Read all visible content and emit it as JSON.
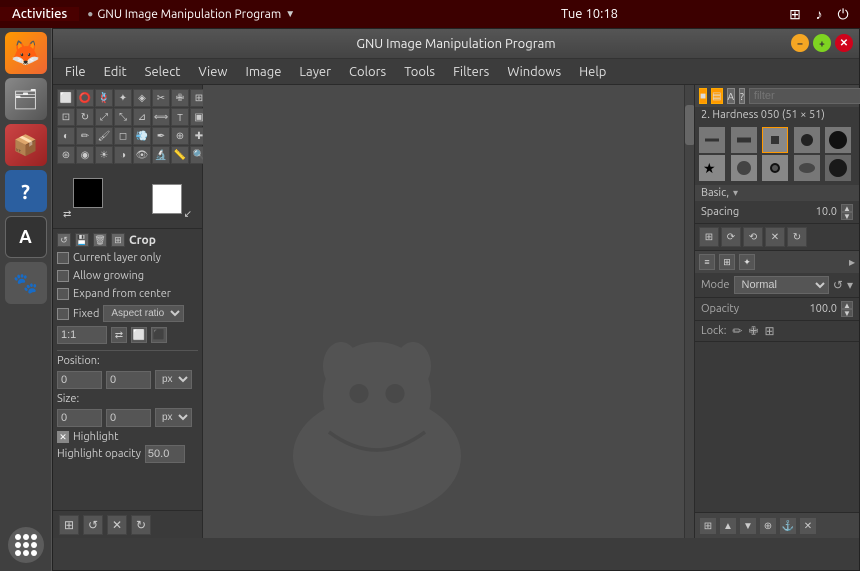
{
  "system_bar": {
    "activities": "Activities",
    "app_name": "GNU Image Manipulation Program",
    "clock": "Tue 10:18"
  },
  "gimp": {
    "title": "GNU Image Manipulation Program",
    "menubar": {
      "items": [
        "File",
        "Edit",
        "Select",
        "View",
        "Image",
        "Layer",
        "Colors",
        "Tools",
        "Filters",
        "Windows",
        "Help"
      ]
    },
    "toolbox": {
      "crop_label": "Crop",
      "current_layer_only": "Current layer only",
      "allow_growing": "Allow growing",
      "expand_from_center": "Expand from center",
      "fixed_label": "Fixed",
      "aspect_ratio": "Aspect ratio",
      "ratio_value": "1:1",
      "position_label": "Position:",
      "pos_x": "0",
      "pos_y": "0",
      "size_label": "Size:",
      "size_x": "0",
      "size_y": "0",
      "highlight": "Highlight",
      "highlight_opacity_label": "Highlight opacity",
      "highlight_opacity_value": "50.0",
      "px_unit": "px"
    },
    "brush_panel": {
      "filter_placeholder": "filter",
      "brush_name": "2. Hardness 050 (51 × 51)",
      "category": "Basic,",
      "spacing_label": "Spacing",
      "spacing_value": "10.0"
    },
    "layers_panel": {
      "mode_label": "Mode",
      "mode_value": "Normal",
      "opacity_label": "Opacity",
      "opacity_value": "100.0",
      "lock_label": "Lock:"
    }
  }
}
